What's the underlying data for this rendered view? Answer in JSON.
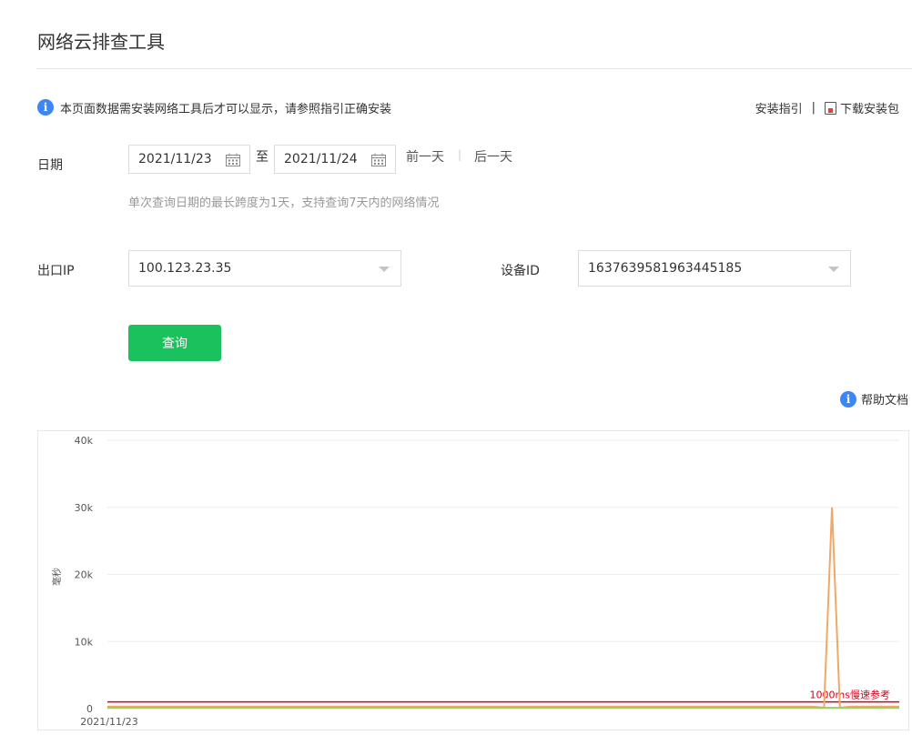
{
  "page": {
    "title": "网络云排查工具"
  },
  "notice": {
    "text": "本页面数据需安装网络工具后才可以显示，请参照指引正确安装"
  },
  "toplinks": {
    "install_guide": "安装指引",
    "separator": "|",
    "download": "下载安装包"
  },
  "filters": {
    "date_label": "日期",
    "date_from": "2021/11/23",
    "to_label": "至",
    "date_to": "2021/11/24",
    "prev_day": "前一天",
    "divider": "|",
    "next_day": "后一天",
    "hint": "单次查询日期的最长跨度为1天，支持查询7天内的网络情况",
    "ip_label": "出口IP",
    "ip_value": "100.123.23.35",
    "device_label": "设备ID",
    "device_value": "1637639581963445185",
    "query_button": "查询"
  },
  "help": {
    "label": "帮助文档"
  },
  "colors": {
    "primary": "#1bc15c",
    "info": "#3d86f5",
    "threshold": "#d0021b",
    "series": "#f0a868",
    "series2": "#9ccc65"
  },
  "chart_data": {
    "type": "line",
    "ylabel": "毫秒",
    "yticks": [
      "40k",
      "30k",
      "20k",
      "10k",
      "0"
    ],
    "ylim": [
      0,
      40000
    ],
    "xtick_first": "2021/11/23",
    "grid": true,
    "threshold": {
      "value": 1000,
      "label": "1000ms慢速参考"
    },
    "series": [
      {
        "color": "#f0a868",
        "points": [
          [
            0,
            300
          ],
          [
            0.89,
            300
          ],
          [
            0.905,
            150
          ],
          [
            0.915,
            30000
          ],
          [
            0.925,
            150
          ],
          [
            0.94,
            300
          ],
          [
            1,
            300
          ]
        ]
      },
      {
        "color": "#9ccc65",
        "points": [
          [
            0,
            120
          ],
          [
            1,
            120
          ]
        ]
      }
    ]
  }
}
